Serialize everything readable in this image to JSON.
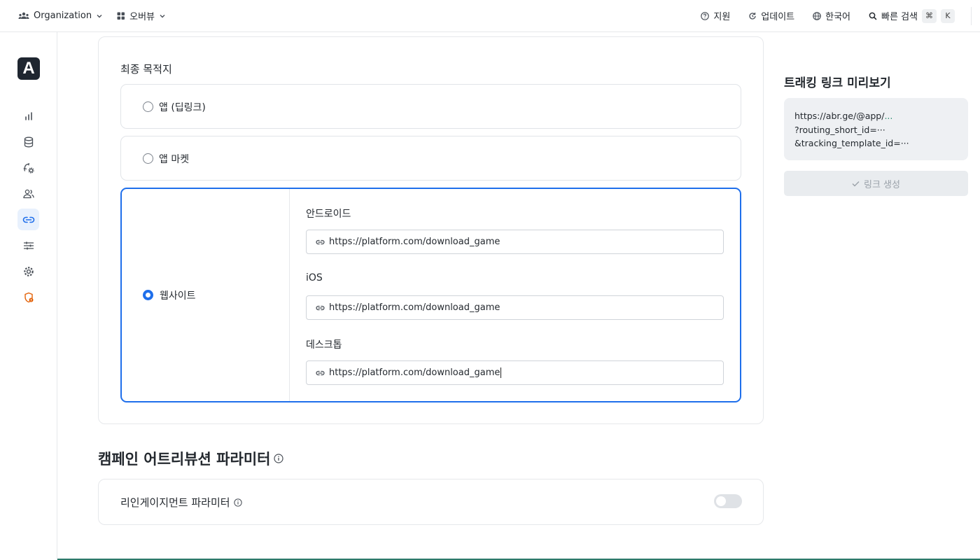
{
  "topbar": {
    "org_label": "Organization",
    "overview_label": "오버뷰",
    "support_label": "지원",
    "updates_label": "업데이트",
    "language_label": "한국어",
    "search_label": "빠른 검색",
    "shortcut_cmd": "⌘",
    "shortcut_key": "K"
  },
  "sidebar": {
    "logo_letter": "A",
    "items": [
      {
        "icon": "bar-chart-icon",
        "active": false
      },
      {
        "icon": "database-icon",
        "active": false
      },
      {
        "icon": "refresh-gear-icon",
        "active": false
      },
      {
        "icon": "users-icon",
        "active": false
      },
      {
        "icon": "link-icon",
        "active": true
      },
      {
        "icon": "sliders-icon",
        "active": false
      },
      {
        "icon": "settings-icon",
        "active": false
      },
      {
        "icon": "shield-alert-icon",
        "active": false
      }
    ]
  },
  "destination": {
    "section_label": "최종 목적지",
    "options": [
      {
        "label": "앱 (딥링크)",
        "selected": false
      },
      {
        "label": "앱 마켓",
        "selected": false
      },
      {
        "label": "웹사이트",
        "selected": true
      }
    ],
    "fields": {
      "android_label": "안드로이드",
      "android_value": "https://platform.com/download_game",
      "ios_label": "iOS",
      "ios_value": "https://platform.com/download_game",
      "desktop_label": "데스크톱",
      "desktop_value": "https://platform.com/download_game"
    }
  },
  "attribution": {
    "title": "캠페인 어트리뷰션 파라미터",
    "reengagement_label": "리인게이지먼트 파라미터",
    "reengagement_enabled": false
  },
  "preview": {
    "title": "트래킹 링크 미리보기",
    "line1": "https://abr.ge/@app/",
    "line1_suffix": "...",
    "line2": "?routing_short_id=···",
    "line3": "&tracking_template_id=···",
    "generate_label": "링크 생성"
  },
  "colors": {
    "accent": "#1f6feb",
    "active_nav_bg": "#e8f1fd",
    "warning_icon": "#e36209",
    "bottom_bar": "#2d7a6b"
  }
}
